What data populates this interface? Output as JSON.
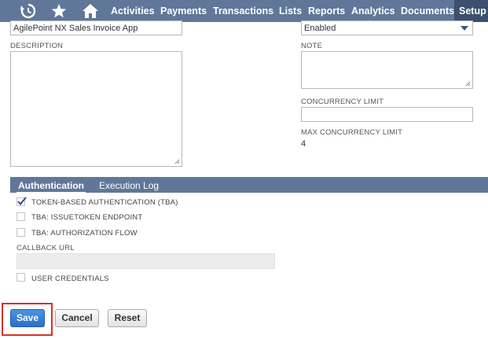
{
  "nav": {
    "items": [
      "Activities",
      "Payments",
      "Transactions",
      "Lists",
      "Reports",
      "Analytics",
      "Documents",
      "Setup"
    ],
    "active": "Setup",
    "icons": [
      "recent-records-icon",
      "star-icon",
      "home-icon"
    ]
  },
  "form": {
    "name_value": "AgilePoint NX Sales Invoice App",
    "state_value": "Enabled",
    "description_label": "DESCRIPTION",
    "note_label": "NOTE",
    "concurrency_limit_label": "CONCURRENCY LIMIT",
    "max_concurrency_label": "MAX CONCURRENCY LIMIT",
    "max_concurrency_value": "4"
  },
  "tabs": {
    "authentication": "Authentication",
    "execution_log": "Execution Log"
  },
  "auth": {
    "tba_label": "TOKEN-BASED AUTHENTICATION (TBA)",
    "tba_checked": true,
    "issuetoken_label": "TBA: ISSUETOKEN ENDPOINT",
    "authflow_label": "TBA: AUTHORIZATION FLOW",
    "callback_label": "CALLBACK URL",
    "user_credentials_label": "USER CREDENTIALS"
  },
  "buttons": {
    "save": "Save",
    "cancel": "Cancel",
    "reset": "Reset"
  },
  "colors": {
    "nav_bg": "#607799",
    "nav_active": "#3c4f6e",
    "primary": "#2f76d2",
    "highlight": "#d9302a"
  }
}
